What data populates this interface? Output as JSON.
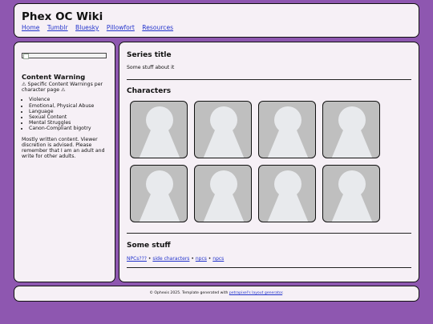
{
  "header": {
    "title": "Phex OC Wiki",
    "nav": [
      "Home",
      "Tumblr",
      "Bluesky",
      "Pillowfort",
      "Resources"
    ]
  },
  "sidebar": {
    "cw_heading": "Content Warning",
    "cw_specific": "⚠ Specific Content Warnings per character page ⚠",
    "cw_items": [
      "Violence",
      "Emotional, Physical Abuse",
      "Language",
      "Sexual Content",
      "Mental Struggles",
      "Canon-Compliant bigotry"
    ],
    "note": "Mostly written content. Viewer discretion is advised. Please remember that I am an adult and write for other adults."
  },
  "main": {
    "series_title": "Series title",
    "series_desc": "Some stuff about it",
    "characters_title": "Characters",
    "character_count": 8,
    "stuff_title": "Some stuff",
    "stuff_links": [
      "NPCs???",
      "side characters",
      "npcs",
      "npcs"
    ],
    "separator": "•"
  },
  "footer": {
    "text": "© Ophexis 2025. Template generated with ",
    "link": "petrapixel's layout generator",
    "end": "."
  },
  "colors": {
    "background": "#8e57b0",
    "panel": "#f6f0f6",
    "link": "#2233cc",
    "placeholder_bg": "#bfbfbf",
    "placeholder_figure": "#e8eaed"
  }
}
